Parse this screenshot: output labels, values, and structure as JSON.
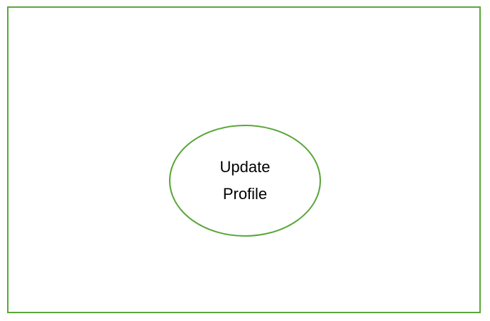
{
  "diagram": {
    "use_cases": [
      {
        "label_lines": [
          "Update",
          "Profile"
        ]
      }
    ]
  },
  "colors": {
    "stroke": "#5aa63a",
    "background": "#ffffff",
    "text": "#000000"
  }
}
